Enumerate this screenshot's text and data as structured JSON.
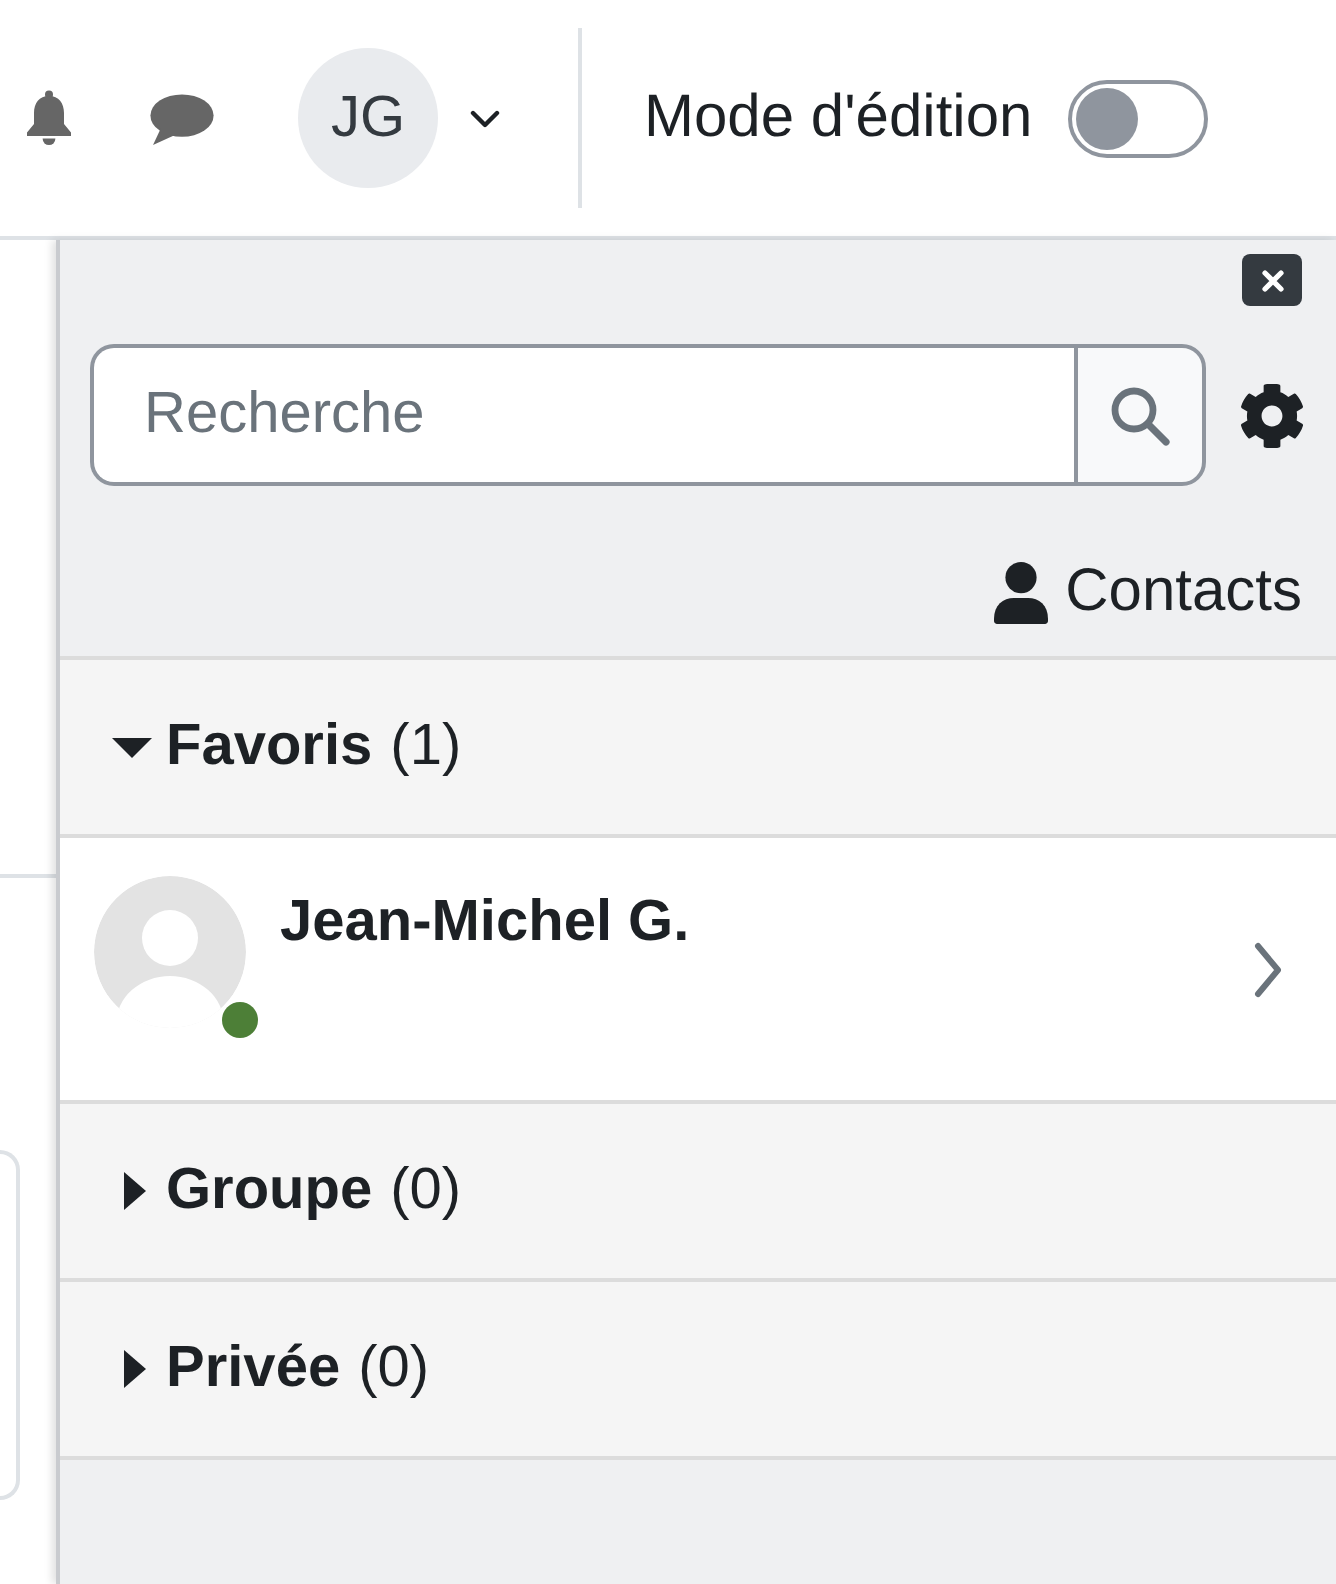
{
  "header": {
    "avatar": {
      "initials": "JG"
    },
    "edit_mode": {
      "label": "Mode d'édition",
      "on": false
    }
  },
  "drawer": {
    "search": {
      "placeholder": "Recherche"
    },
    "contacts_link": "Contacts",
    "sections": [
      {
        "title": "Favoris",
        "count": "(1)",
        "expanded": true,
        "contacts": [
          {
            "name": "Jean-Michel G.",
            "online": true
          }
        ]
      },
      {
        "title": "Groupe",
        "count": "(0)",
        "expanded": false
      },
      {
        "title": "Privée",
        "count": "(0)",
        "expanded": false
      }
    ]
  }
}
